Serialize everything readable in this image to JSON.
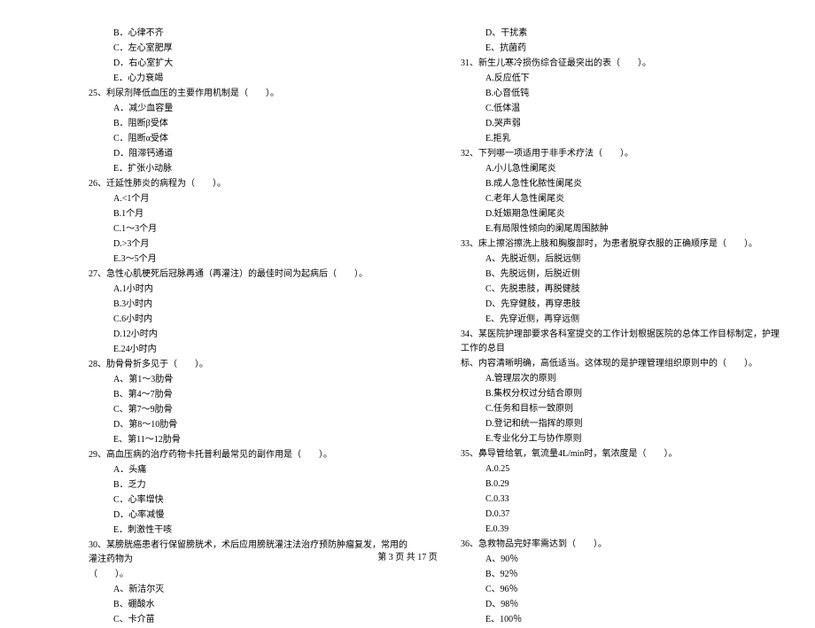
{
  "left_column": {
    "prefix_options": [
      "B．心律不齐",
      "C．左心室肥厚",
      "D．右心室扩大",
      "E．心力衰竭"
    ],
    "q25": {
      "text": "25、利尿剂降低血压的主要作用机制是（　　）。",
      "options": [
        "A．减少血容量",
        "B．阻断β受体",
        "C．阻断α受体",
        "D．阻滞钙通道",
        "E．扩张小动脉"
      ]
    },
    "q26": {
      "text": "26、迁延性肺炎的病程为（　　）。",
      "options": [
        "A.<1个月",
        "B.1个月",
        "C.1～3个月",
        "D.>3个月",
        "E.3～5个月"
      ]
    },
    "q27": {
      "text": "27、急性心肌梗死后冠脉再通（再灌注）的最佳时间为起病后（　　）。",
      "options": [
        "A.1小时内",
        "B.3小时内",
        "C.6小时内",
        "D.12小时内",
        "E.24小时内"
      ]
    },
    "q28": {
      "text": "28、肋骨骨折多见于（　　）。",
      "options": [
        "A、第1～3肋骨",
        "B、第4～7肋骨",
        "C、第7～9肋骨",
        "D、第8～10肋骨",
        "E、第11～12肋骨"
      ]
    },
    "q29": {
      "text": "29、高血压病的治疗药物卡托普利最常见的副作用是（　　）。",
      "options": [
        "A．头痛",
        "B．乏力",
        "C．心率增快",
        "D．心率减慢",
        "E．刺激性干咳"
      ]
    },
    "q30": {
      "text1": "30、某膀胱癌患者行保留膀胱术，术后应用膀胱灌注法治疗预防肿瘤复发，常用的灌注药物为",
      "text2": "（　　）。",
      "options": [
        "A、新洁尔灭",
        "B、硼酸水",
        "C、卡介苗"
      ]
    }
  },
  "right_column": {
    "prefix_options": [
      "D、干扰素",
      "E、抗菌药"
    ],
    "q31": {
      "text": "31、新生儿寒冷损伤综合征最突出的表（　　）。",
      "options": [
        "A.反应低下",
        "B.心音低钝",
        "C.低体温",
        "D.哭声弱",
        "E.拒乳"
      ]
    },
    "q32": {
      "text": "32、下列哪一项适用于非手术疗法（　　）。",
      "options": [
        "A.小儿急性阑尾炎",
        "B.成人急性化脓性阑尾炎",
        "C.老年人急性阑尾炎",
        "D.妊娠期急性阑尾炎",
        "E.有局限性倾向的阑尾周围脓肿"
      ]
    },
    "q33": {
      "text": "33、床上擦浴擦洗上肢和胸腹部时，为患者脱穿衣服的正确顺序是（　　）。",
      "options": [
        "A、先脱近侧，后脱远侧",
        "B、先脱远侧，后脱近侧",
        "C、先脱患肢，再脱健肢",
        "D、先穿健肢，再穿患肢",
        "E、先穿近侧，再穿远侧"
      ]
    },
    "q34": {
      "text1": "34、某医院护理部要求各科室提交的工作计划根据医院的总体工作目标制定，护理工作的总目",
      "text2": "标、内容清晰明确，高低适当。这体现的是护理管理组织原则中的（　　）。",
      "options": [
        "A.管理层次的原则",
        "B.集权分权过分结合原则",
        "C.任务和目标一致原则",
        "D.登记和统一指挥的原则",
        "E.专业化分工与协作原则"
      ]
    },
    "q35": {
      "text": "35、鼻导管给氧，氧流量4L/min时，氧浓度是（　　）。",
      "options": [
        "A.0.25",
        "B.0.29",
        "C.0.33",
        "D.0.37",
        "E.0.39"
      ]
    },
    "q36": {
      "text": "36、急救物品完好率需达到（　　）。",
      "options": [
        "A、90％",
        "B、92％",
        "C、96％",
        "D、98％",
        "E、100％"
      ]
    }
  },
  "footer": "第 3 页 共 17 页"
}
